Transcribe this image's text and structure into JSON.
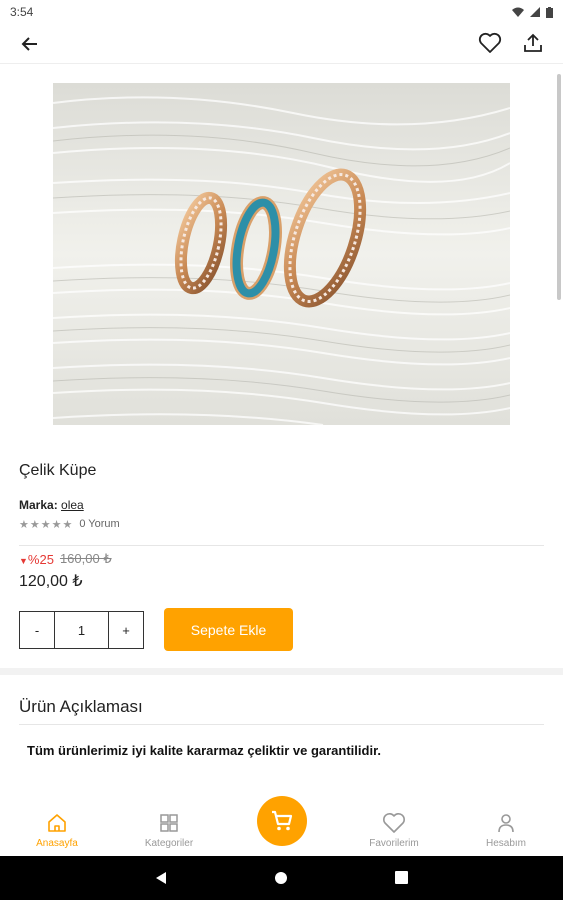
{
  "status_bar": {
    "time": "3:54"
  },
  "product": {
    "title": "Çelik Küpe",
    "brand_label": "Marka:",
    "brand_name": "olea",
    "stars": "★★★★★",
    "review_count": "0 Yorum",
    "discount_arrow": "▼",
    "discount": "%25",
    "old_price": "160,00 ₺",
    "price": "120,00 ₺",
    "quantity": "1",
    "minus_label": "-",
    "plus_label": "+",
    "add_to_cart_label": "Sepete Ekle"
  },
  "description": {
    "title": "Ürün Açıklaması",
    "text": "Tüm ürünlerimiz iyi kalite kararmaz çeliktir ve garantilidir."
  },
  "bottom_nav": {
    "items": [
      {
        "label": "Anasayfa",
        "icon": "home-icon",
        "active": true
      },
      {
        "label": "Kategoriler",
        "icon": "grid-icon",
        "active": false
      },
      {
        "label": "Favorilerim",
        "icon": "heart-icon",
        "active": false
      },
      {
        "label": "Hesabım",
        "icon": "user-icon",
        "active": false
      }
    ],
    "cart_icon": "cart-icon"
  },
  "colors": {
    "accent": "#ffa200",
    "discount": "#e53935"
  }
}
